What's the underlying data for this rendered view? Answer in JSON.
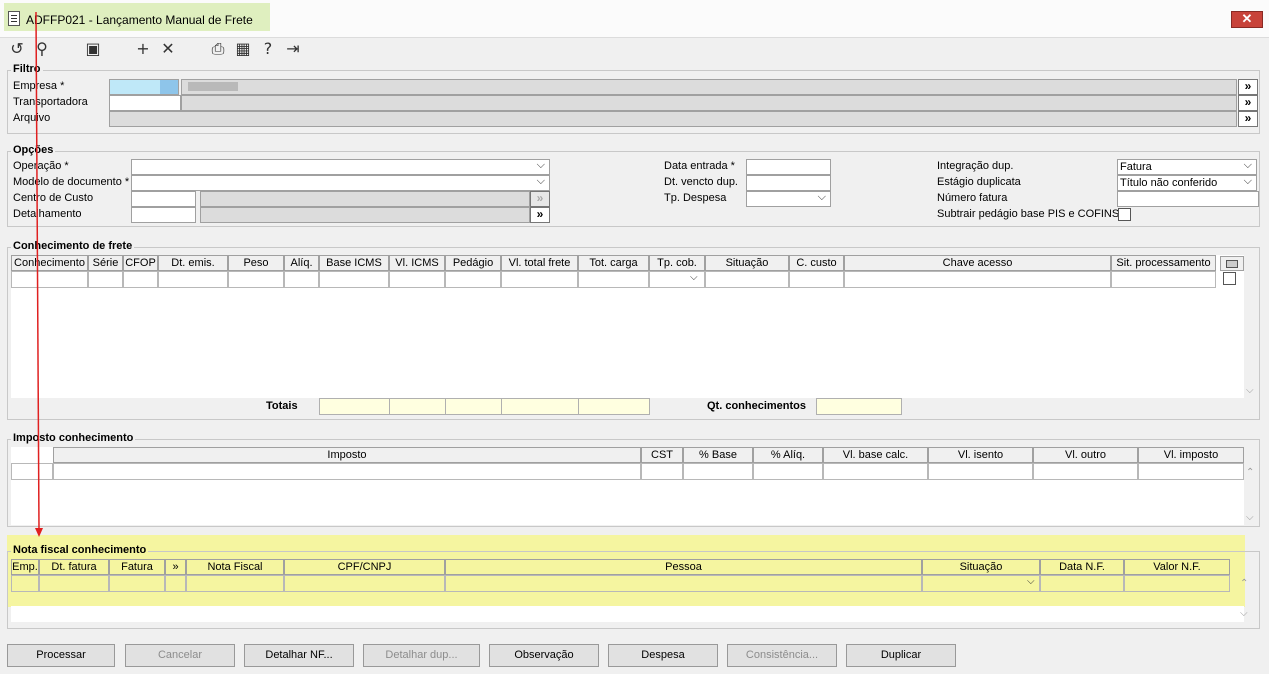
{
  "window": {
    "title": "ADFFP021 - Lançamento Manual de Frete",
    "close_label": "✕"
  },
  "toolbar": {
    "icons": [
      "undo-icon",
      "search-icon",
      "save-icon",
      "add-icon",
      "delete-icon",
      "print-icon",
      "calendar-icon",
      "help-icon",
      "exit-icon"
    ]
  },
  "filtro": {
    "title": "Filtro",
    "empresa_label": "Empresa *",
    "transportadora_label": "Transportadora",
    "arquivo_label": "Arquivo",
    "more": "»"
  },
  "opcoes": {
    "title": "Opções",
    "operacao_label": "Operação *",
    "modelo_label": "Modelo de documento *",
    "centro_label": "Centro de Custo",
    "detalhamento_label": "Detalhamento",
    "data_entrada_label": "Data entrada *",
    "dt_vencto_label": "Dt. vencto dup.",
    "tp_despesa_label": "Tp. Despesa",
    "integracao_label": "Integração dup.",
    "integracao_value": "Fatura",
    "estagio_label": "Estágio duplicata",
    "estagio_value": "Título não conferido",
    "numero_fatura_label": "Número fatura",
    "subtrair_label": "Subtrair pedágio base PIS e COFINS",
    "more": "»"
  },
  "conhecimento": {
    "title": "Conhecimento de frete",
    "columns": [
      "Conhecimento",
      "Série",
      "CFOP",
      "Dt. emis.",
      "Peso",
      "Alíq.",
      "Base ICMS",
      "Vl. ICMS",
      "Pedágio",
      "Vl. total frete",
      "Tot. carga",
      "Tp. cob.",
      "Situação",
      "C. custo",
      "Chave acesso",
      "Sit. processamento"
    ],
    "totais_label": "Totais",
    "qt_label": "Qt. conhecimentos"
  },
  "imposto": {
    "title": "Imposto conhecimento",
    "columns": [
      "Imposto",
      "CST",
      "% Base",
      "% Alíq.",
      "Vl. base calc.",
      "Vl. isento",
      "Vl. outro",
      "Vl. imposto"
    ]
  },
  "nota": {
    "title": "Nota fiscal conhecimento",
    "columns": [
      "Emp.",
      "Dt. fatura",
      "Fatura",
      "»",
      "Nota Fiscal",
      "CPF/CNPJ",
      "Pessoa",
      "Situação",
      "Data N.F.",
      "Valor N.F."
    ]
  },
  "buttons": {
    "processar": "Processar",
    "cancelar": "Cancelar",
    "detalhar_nf": "Detalhar NF...",
    "detalhar_dup": "Detalhar dup...",
    "observacao": "Observação",
    "despesa": "Despesa",
    "consistencia": "Consistência...",
    "duplicar": "Duplicar"
  },
  "colors": {
    "highlight_yellow": "#f5f5a0",
    "title_green": "#dfefbf",
    "annotation_red": "#e02020"
  }
}
